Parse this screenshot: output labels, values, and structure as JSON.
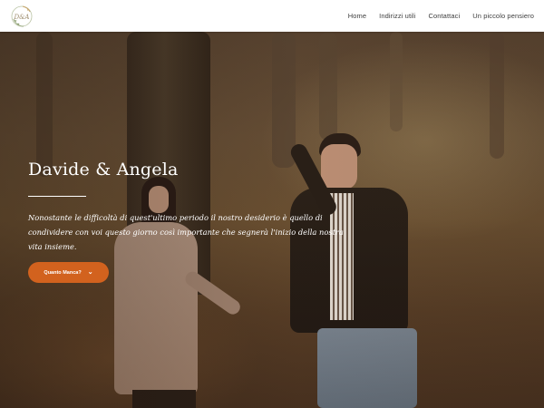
{
  "logo": {
    "icon": "monogram-wreath-icon",
    "text": "D&A"
  },
  "nav": {
    "items": [
      {
        "label": "Home"
      },
      {
        "label": "Indirizzi utili"
      },
      {
        "label": "Contattaci"
      },
      {
        "label": "Un piccolo pensiero"
      }
    ]
  },
  "hero": {
    "title": "Davide & Angela",
    "subtitle": "Nonostante le difficoltà di quest'ultimo periodo il nostro desiderio è quello di condividere con voi questo giorno così importante che segnerà l'inizio della nostra vita insieme.",
    "cta_label": "Quanto Manca?",
    "cta_icon": "chevron-down-icon",
    "accent_color": "#d2621e"
  }
}
